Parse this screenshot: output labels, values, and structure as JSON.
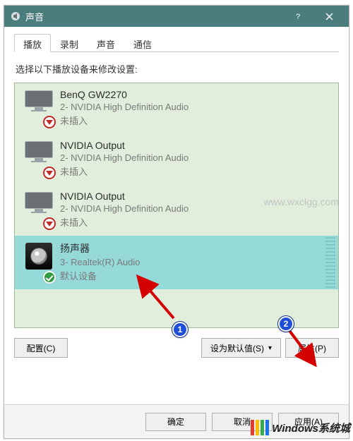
{
  "titlebar": {
    "title": "声音"
  },
  "tabs": [
    {
      "label": "播放",
      "active": true
    },
    {
      "label": "录制",
      "active": false
    },
    {
      "label": "声音",
      "active": false
    },
    {
      "label": "通信",
      "active": false
    }
  ],
  "instruction": "选择以下播放设备来修改设置:",
  "devices": [
    {
      "name": "BenQ GW2270",
      "sub": "2- NVIDIA High Definition Audio",
      "status": "未插入",
      "icon": "monitor",
      "badge": "unplugged",
      "selected": false
    },
    {
      "name": "NVIDIA Output",
      "sub": "2- NVIDIA High Definition Audio",
      "status": "未插入",
      "icon": "monitor",
      "badge": "unplugged",
      "selected": false
    },
    {
      "name": "NVIDIA Output",
      "sub": "2- NVIDIA High Definition Audio",
      "status": "未插入",
      "icon": "monitor",
      "badge": "unplugged",
      "selected": false
    },
    {
      "name": "扬声器",
      "sub": "3- Realtek(R) Audio",
      "status": "默认设备",
      "icon": "speaker",
      "badge": "default",
      "selected": true
    }
  ],
  "buttons": {
    "configure": "配置(C)",
    "set_default": "设为默认值(S)",
    "properties": "属性(P)"
  },
  "dialog_buttons": {
    "ok": "确定",
    "cancel": "取消",
    "apply": "应用(A)"
  },
  "annotations": {
    "badge1": "1",
    "badge2": "2"
  },
  "watermark": {
    "text": "Windows系统城",
    "faint": "www.wxclgg.com"
  }
}
